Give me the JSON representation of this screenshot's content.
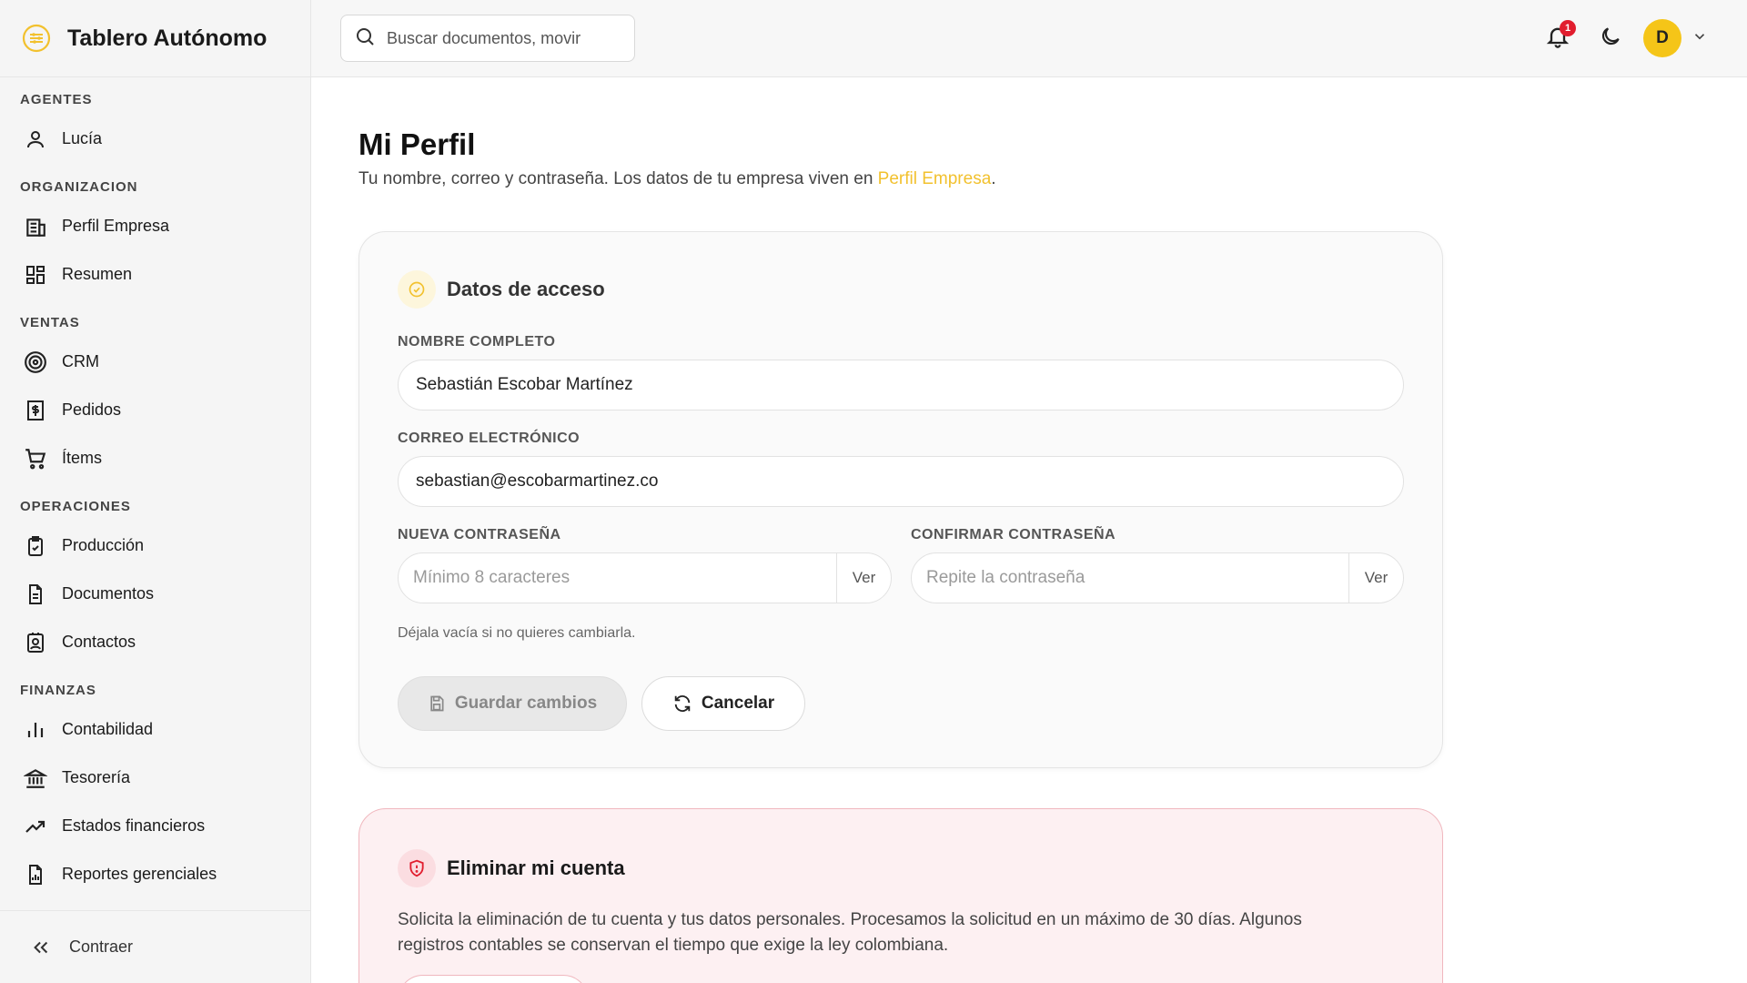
{
  "app": {
    "title": "Tablero Autónomo"
  },
  "sidebar": {
    "sections": [
      {
        "title": "AGENTES",
        "items": [
          {
            "label": "Lucía",
            "icon": "user-icon"
          }
        ]
      },
      {
        "title": "ORGANIZACION",
        "items": [
          {
            "label": "Perfil Empresa",
            "icon": "building-icon"
          },
          {
            "label": "Resumen",
            "icon": "dashboard-icon"
          }
        ]
      },
      {
        "title": "VENTAS",
        "items": [
          {
            "label": "CRM",
            "icon": "target-icon"
          },
          {
            "label": "Pedidos",
            "icon": "receipt-icon"
          },
          {
            "label": "Ítems",
            "icon": "cart-icon"
          }
        ]
      },
      {
        "title": "OPERACIONES",
        "items": [
          {
            "label": "Producción",
            "icon": "clipboard-icon"
          },
          {
            "label": "Documentos",
            "icon": "document-icon"
          },
          {
            "label": "Contactos",
            "icon": "contact-icon"
          }
        ]
      },
      {
        "title": "FINANZAS",
        "items": [
          {
            "label": "Contabilidad",
            "icon": "bar-chart-icon"
          },
          {
            "label": "Tesorería",
            "icon": "bank-icon"
          },
          {
            "label": "Estados financieros",
            "icon": "trending-up-icon"
          },
          {
            "label": "Reportes gerenciales",
            "icon": "report-icon"
          }
        ]
      }
    ],
    "collapse_label": "Contraer"
  },
  "topbar": {
    "search_placeholder": "Buscar documentos, movir",
    "notification_count": "1",
    "avatar_initial": "D"
  },
  "page": {
    "title": "Mi Perfil",
    "subtitle_prefix": "Tu nombre, correo y contraseña. Los datos de tu empresa viven en ",
    "subtitle_link": "Perfil Empresa",
    "subtitle_suffix": "."
  },
  "access_card": {
    "title": "Datos de acceso",
    "name_label": "NOMBRE COMPLETO",
    "name_value": "Sebastián Escobar Martínez",
    "email_label": "CORREO ELECTRÓNICO",
    "email_value": "sebastian@escobarmartinez.co",
    "new_password_label": "NUEVA CONTRASEÑA",
    "new_password_placeholder": "Mínimo 8 caracteres",
    "confirm_password_label": "CONFIRMAR CONTRASEÑA",
    "confirm_password_placeholder": "Repite la contraseña",
    "show_label": "Ver",
    "hint": "Déjala vacía si no quieres cambiarla.",
    "save_label": "Guardar cambios",
    "cancel_label": "Cancelar"
  },
  "delete_card": {
    "title": "Eliminar mi cuenta",
    "text": "Solicita la eliminación de tu cuenta y tus datos personales. Procesamos la solicitud en un máximo de 30 días. Algunos registros contables se conservan el tiempo que exige la ley colombiana."
  },
  "colors": {
    "accent": "#f2c12e",
    "danger": "#e11d2e"
  }
}
